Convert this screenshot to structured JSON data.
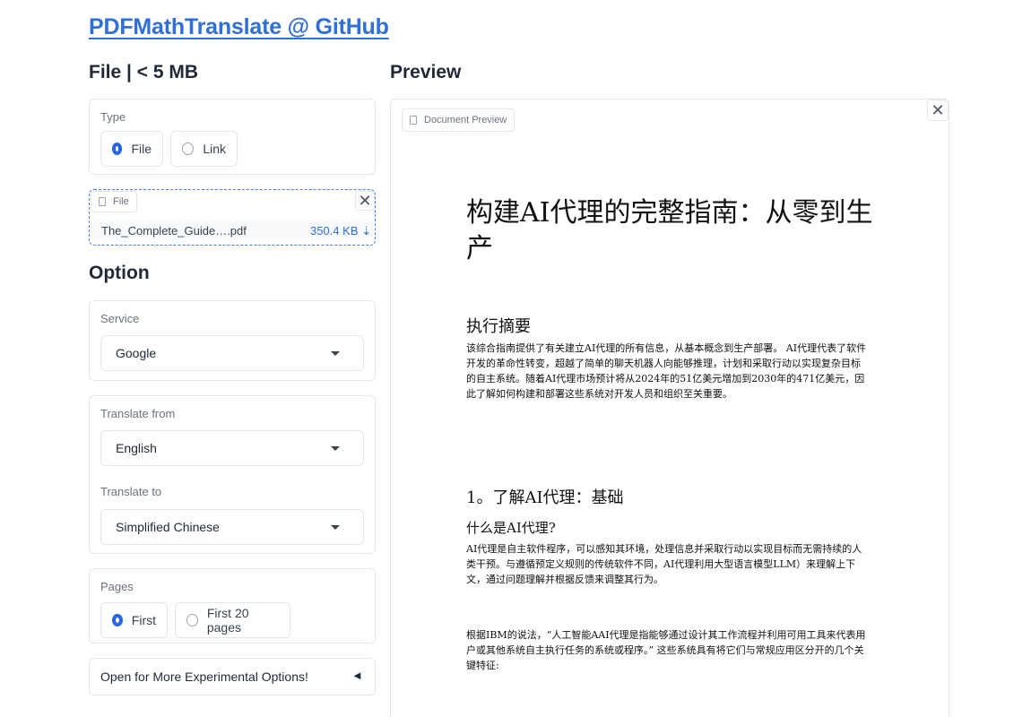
{
  "header": {
    "title": "PDFMathTranslate @ GitHub"
  },
  "file_section": {
    "heading": "File | < 5 MB",
    "type": {
      "label": "Type",
      "options": [
        "File",
        "Link"
      ],
      "selected": "File"
    },
    "upload": {
      "tag": "File",
      "filename": "The_Complete_Guide….pdf",
      "size": "350.4 KB",
      "download_icon": "⇣"
    }
  },
  "option_section": {
    "heading": "Option",
    "service": {
      "label": "Service",
      "value": "Google"
    },
    "translate_from": {
      "label": "Translate from",
      "value": "English"
    },
    "translate_to": {
      "label": "Translate to",
      "value": "Simplified Chinese"
    },
    "pages": {
      "label": "Pages",
      "options": [
        "First",
        "First 20 pages"
      ],
      "selected": "First"
    },
    "experimental": {
      "label": "Open for More Experimental Options!",
      "icon": "◄"
    }
  },
  "preview": {
    "heading": "Preview",
    "tag": "Document Preview",
    "close_icon": "✕",
    "document": {
      "title": "构建AI代理的完整指南：从零到生产",
      "sections": [
        {
          "heading": "执行摘要",
          "paragraphs": [
            "该综合指南提供了有关建立AI代理的所有信息，从基本概念到生产部署。 AI代理代表了软件开发的革命性转变，超越了简单的聊天机器人向能够推理，计划和采取行动以实现复杂目标的自主系统。随着AI代理市场预计将从2024年的51亿美元增加到2030年的471亿美元，因此了解如何构建和部署这些系统对开发人员和组织至关重要。"
          ]
        },
        {
          "heading": "1。了解AI代理：基础",
          "subheading": "什么是AI代理?",
          "paragraphs": [
            "AI代理是自主软件程序，可以感知其环境，处理信息并采取行动以实现目标而无需持续的人类干预。与遵循预定义规则的传统软件不同，AI代理利用大型语言模型LLM）来理解上下文，通过问题理解并根据反馈来调整其行为。",
            "根据IBM的说法，“人工智能AAI代理是指能够通过设计其工作流程并利用可用工具来代表用户或其他系统自主执行任务的系统或程序。” 这些系统具有将它们与常规应用区分开的几个关键特征:"
          ]
        }
      ]
    }
  },
  "colors": {
    "accent": "#2563eb",
    "link": "#2f6fd6",
    "border": "#e5e7eb"
  }
}
